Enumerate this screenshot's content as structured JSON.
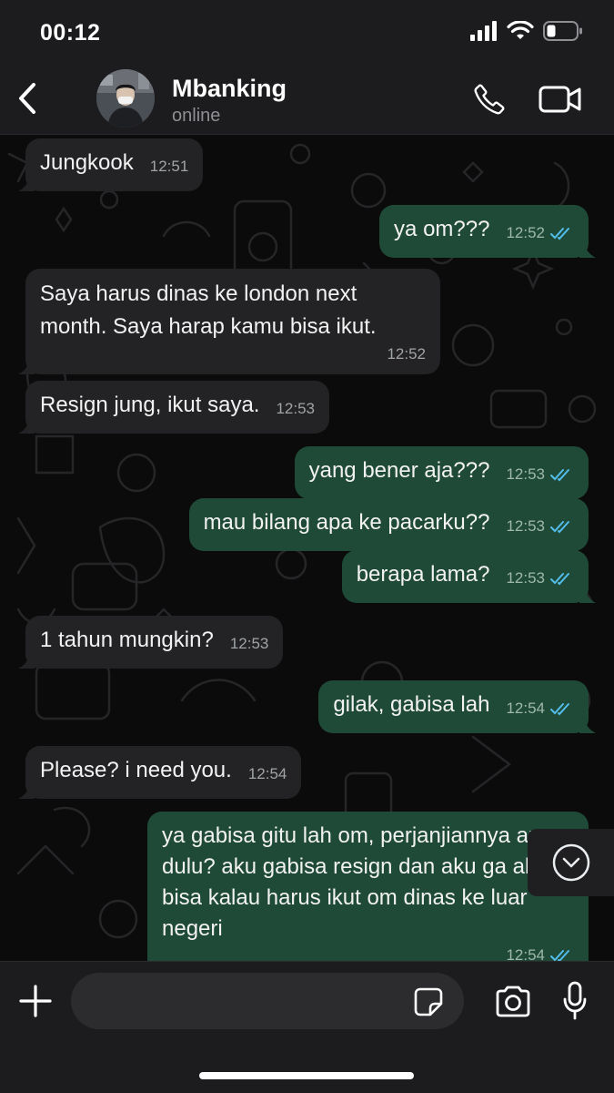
{
  "status_bar": {
    "time": "00:12"
  },
  "header": {
    "contact_name": "Mbanking",
    "contact_status": "online"
  },
  "messages": [
    {
      "direction": "in",
      "text": "Jungkook",
      "time": "12:51"
    },
    {
      "direction": "out",
      "text": "ya om???",
      "time": "12:52",
      "ticks": "read"
    },
    {
      "direction": "in",
      "text": "Saya harus dinas ke london next month. Saya harap kamu bisa ikut.",
      "time": "12:52"
    },
    {
      "direction": "in",
      "text": "Resign jung, ikut saya.",
      "time": "12:53"
    },
    {
      "direction": "out",
      "text": "yang bener aja???",
      "time": "12:53",
      "ticks": "read"
    },
    {
      "direction": "out",
      "text": "mau bilang apa ke pacarku??",
      "time": "12:53",
      "ticks": "read"
    },
    {
      "direction": "out",
      "text": "berapa lama?",
      "time": "12:53",
      "ticks": "read"
    },
    {
      "direction": "in",
      "text": "1 tahun mungkin?",
      "time": "12:53"
    },
    {
      "direction": "out",
      "text": "gilak, gabisa lah",
      "time": "12:54",
      "ticks": "read"
    },
    {
      "direction": "in",
      "text": "Please? i need you.",
      "time": "12:54"
    },
    {
      "direction": "out",
      "text": "ya gabisa gitu lah om, perjanjiannya apa dulu? aku gabisa resign dan aku ga akan bisa kalau harus ikut om dinas ke luar negeri",
      "time": "12:54",
      "ticks": "read"
    }
  ],
  "input": {
    "placeholder": ""
  },
  "colors": {
    "incoming_bubble": "#232325",
    "outgoing_bubble": "#1f4a37",
    "read_ticks": "#53bdeb",
    "background": "#0b0b0c"
  }
}
